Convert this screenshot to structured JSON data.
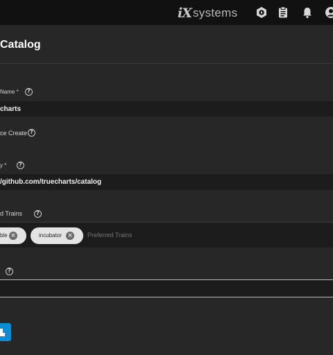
{
  "header": {
    "brand_prefix": "iX",
    "brand_name": "systems",
    "icons": [
      "truecommand-icon",
      "clipboard-icon",
      "notifications-bell-icon",
      "account-icon"
    ]
  },
  "form": {
    "title": "Catalog",
    "catalog_name_label": "Name *",
    "catalog_name_value": "charts",
    "force_create_label": "ce Create",
    "repository_label": "y *",
    "repository_value": "/github.com/truecharts/catalog",
    "trains_label": "d Trains",
    "trains": [
      {
        "label": "ble"
      },
      {
        "label": "incubator"
      }
    ],
    "trains_placeholder": "Preferred Trains",
    "branch_value": ""
  },
  "colors": {
    "header_bg": "#111111",
    "panel_bg": "#272727",
    "field_bg": "#1c1c1c",
    "chip_bg": "#e4e4e4",
    "accent": "#0b8dd6"
  }
}
